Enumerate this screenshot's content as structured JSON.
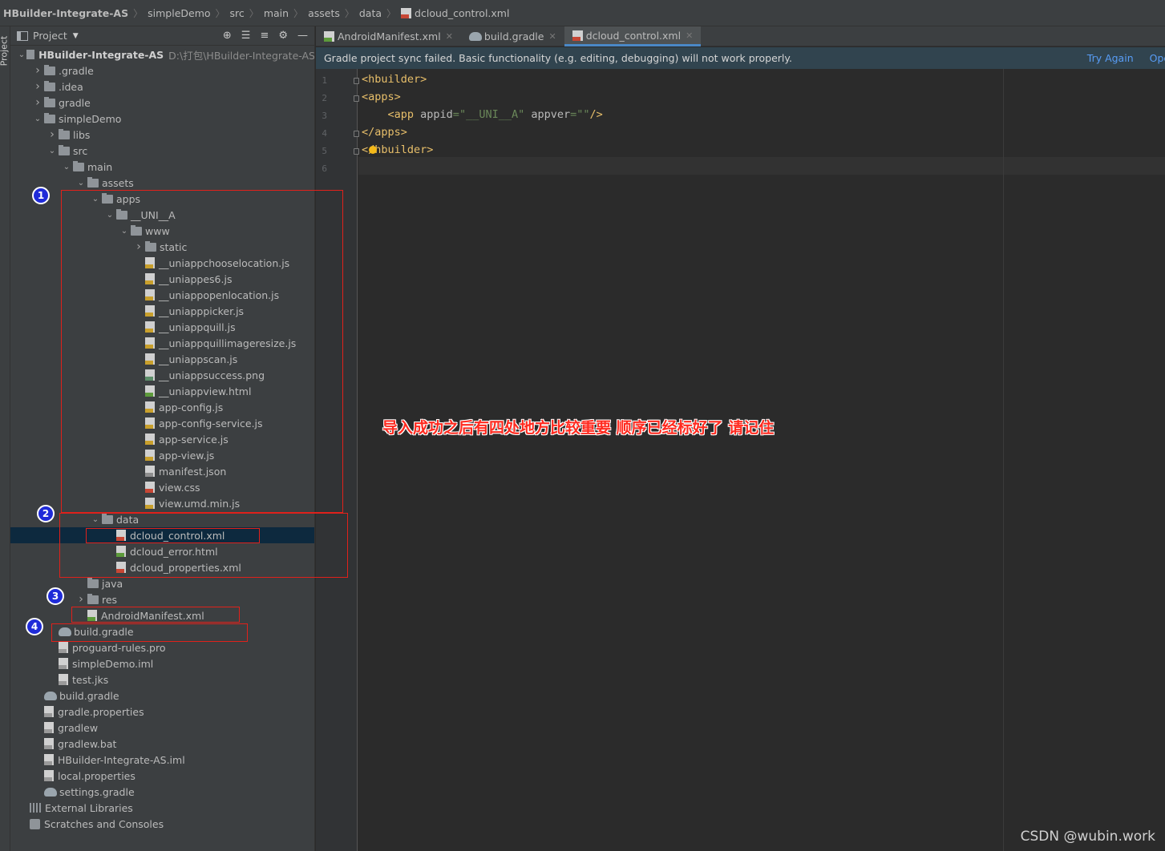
{
  "breadcrumb": {
    "items": [
      "HBuilder-Integrate-AS",
      "simpleDemo",
      "src",
      "main",
      "assets",
      "data",
      "dcloud_control.xml"
    ]
  },
  "toolstrip": {
    "label": "Project"
  },
  "project_panel": {
    "title": "Project",
    "root_path": "D:\\打包\\HBuilder-Integrate-AS",
    "tree": [
      {
        "label": "HBuilder-Integrate-AS",
        "depth": 0,
        "kind": "root",
        "expanded": true
      },
      {
        "label": ".gradle",
        "depth": 1,
        "kind": "folder",
        "expanded": false
      },
      {
        "label": ".idea",
        "depth": 1,
        "kind": "folder",
        "expanded": false
      },
      {
        "label": "gradle",
        "depth": 1,
        "kind": "folder",
        "expanded": false
      },
      {
        "label": "simpleDemo",
        "depth": 1,
        "kind": "folder",
        "expanded": true
      },
      {
        "label": "libs",
        "depth": 2,
        "kind": "folder",
        "expanded": false
      },
      {
        "label": "src",
        "depth": 2,
        "kind": "folder",
        "expanded": true
      },
      {
        "label": "main",
        "depth": 3,
        "kind": "folder",
        "expanded": true
      },
      {
        "label": "assets",
        "depth": 4,
        "kind": "folder",
        "expanded": true
      },
      {
        "label": "apps",
        "depth": 5,
        "kind": "folder",
        "expanded": true
      },
      {
        "label": "__UNI__A",
        "depth": 6,
        "kind": "folder",
        "expanded": true
      },
      {
        "label": "www",
        "depth": 7,
        "kind": "folder",
        "expanded": true
      },
      {
        "label": "static",
        "depth": 8,
        "kind": "folder",
        "expanded": false
      },
      {
        "label": "__uniappchooselocation.js",
        "depth": 8,
        "kind": "js"
      },
      {
        "label": "__uniappes6.js",
        "depth": 8,
        "kind": "js"
      },
      {
        "label": "__uniappopenlocation.js",
        "depth": 8,
        "kind": "js"
      },
      {
        "label": "__uniapppicker.js",
        "depth": 8,
        "kind": "js"
      },
      {
        "label": "__uniappquill.js",
        "depth": 8,
        "kind": "js"
      },
      {
        "label": "__uniappquillimageresize.js",
        "depth": 8,
        "kind": "js"
      },
      {
        "label": "__uniappscan.js",
        "depth": 8,
        "kind": "js"
      },
      {
        "label": "__uniappsuccess.png",
        "depth": 8,
        "kind": "png"
      },
      {
        "label": "__uniappview.html",
        "depth": 8,
        "kind": "html"
      },
      {
        "label": "app-config.js",
        "depth": 8,
        "kind": "js"
      },
      {
        "label": "app-config-service.js",
        "depth": 8,
        "kind": "js"
      },
      {
        "label": "app-service.js",
        "depth": 8,
        "kind": "js"
      },
      {
        "label": "app-view.js",
        "depth": 8,
        "kind": "js"
      },
      {
        "label": "manifest.json",
        "depth": 8,
        "kind": "json"
      },
      {
        "label": "view.css",
        "depth": 8,
        "kind": "css"
      },
      {
        "label": "view.umd.min.js",
        "depth": 8,
        "kind": "js"
      },
      {
        "label": "data",
        "depth": 5,
        "kind": "folder",
        "expanded": true
      },
      {
        "label": "dcloud_control.xml",
        "depth": 6,
        "kind": "xml",
        "selected": true
      },
      {
        "label": "dcloud_error.html",
        "depth": 6,
        "kind": "html"
      },
      {
        "label": "dcloud_properties.xml",
        "depth": 6,
        "kind": "xml"
      },
      {
        "label": "java",
        "depth": 4,
        "kind": "folder",
        "noarrow": true
      },
      {
        "label": "res",
        "depth": 4,
        "kind": "folder",
        "expanded": false
      },
      {
        "label": "AndroidManifest.xml",
        "depth": 4,
        "kind": "mf"
      },
      {
        "label": "build.gradle",
        "depth": 2,
        "kind": "gradle"
      },
      {
        "label": "proguard-rules.pro",
        "depth": 2,
        "kind": "plain"
      },
      {
        "label": "simpleDemo.iml",
        "depth": 2,
        "kind": "plain"
      },
      {
        "label": "test.jks",
        "depth": 2,
        "kind": "plain"
      },
      {
        "label": "build.gradle",
        "depth": 1,
        "kind": "gradle"
      },
      {
        "label": "gradle.properties",
        "depth": 1,
        "kind": "plain"
      },
      {
        "label": "gradlew",
        "depth": 1,
        "kind": "plain"
      },
      {
        "label": "gradlew.bat",
        "depth": 1,
        "kind": "plain"
      },
      {
        "label": "HBuilder-Integrate-AS.iml",
        "depth": 1,
        "kind": "plain"
      },
      {
        "label": "local.properties",
        "depth": 1,
        "kind": "plain"
      },
      {
        "label": "settings.gradle",
        "depth": 1,
        "kind": "gradle"
      },
      {
        "label": "External Libraries",
        "depth": 0,
        "kind": "lib"
      },
      {
        "label": "Scratches and Consoles",
        "depth": 0,
        "kind": "scratch"
      }
    ]
  },
  "tabs": [
    {
      "label": "AndroidManifest.xml",
      "icon": "manifest-file-icon",
      "active": false
    },
    {
      "label": "build.gradle",
      "icon": "gradle-icon",
      "active": false
    },
    {
      "label": "dcloud_control.xml",
      "icon": "xml-file-icon",
      "active": true
    }
  ],
  "banner": {
    "message": "Gradle project sync failed. Basic functionality (e.g. editing, debugging) will not work properly.",
    "try_again": "Try Again",
    "open": "Open 'B"
  },
  "editor": {
    "line_numbers": [
      "1",
      "2",
      "3",
      "4",
      "5",
      "6"
    ],
    "lines": [
      {
        "text": "<hbuilder>"
      },
      {
        "text": "<apps>"
      },
      {
        "indent": "    ",
        "tag_open": "<app ",
        "attr1": "appid",
        "eq1": "=",
        "val1": "\"__UNI__A\"",
        "attr2": " appver",
        "eq2": "=",
        "val2": "\"\"",
        "tag_close": "/>"
      },
      {
        "text": "</apps>"
      },
      {
        "text": "</hbuilder>",
        "shown": "< hbuilder>"
      },
      {
        "text": ""
      }
    ]
  },
  "annotation": {
    "note": "导入成功之后有四处地方比较重要 顺序已经标好了 请记住",
    "badges": [
      "1",
      "2",
      "3",
      "4"
    ]
  },
  "watermark": "CSDN @wubin.work",
  "colors": {
    "accent_blue": "#589df6",
    "annotation_red": "#e0211b",
    "badge_blue": "#1f2bd8",
    "tag_color": "#e8bf6a",
    "string_color": "#6a8759"
  }
}
